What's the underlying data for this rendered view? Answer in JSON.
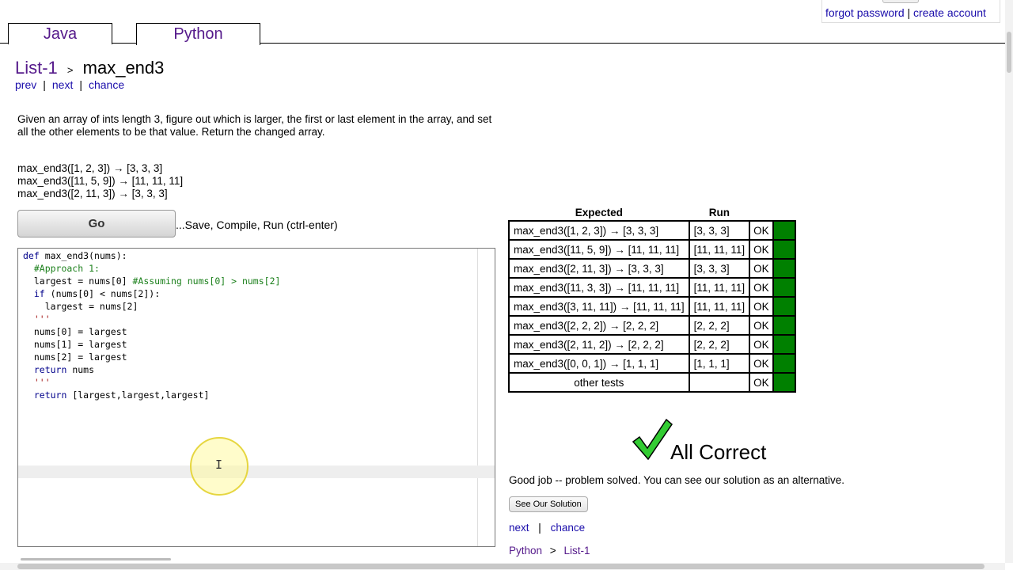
{
  "account": {
    "forgot": "forgot password",
    "sep": "|",
    "create": "create account"
  },
  "tabs": [
    {
      "label": "Java"
    },
    {
      "label": "Python"
    }
  ],
  "breadcrumb": {
    "section": "List-1",
    "sep": ">",
    "problem": "max_end3"
  },
  "nav": {
    "prev": "prev",
    "next": "next",
    "chance": "chance",
    "sep": "|"
  },
  "description": "Given an array of ints length 3, figure out which is larger, the first or last element in the array, and set all the other elements to be that value. Return the changed array.",
  "examples": [
    "max_end3([1, 2, 3]) → [3, 3, 3]",
    "max_end3([11, 5, 9]) → [11, 11, 11]",
    "max_end3([2, 11, 3]) → [3, 3, 3]"
  ],
  "go_button": "Go",
  "go_hint": "...Save, Compile, Run (ctrl-enter)",
  "code_lines": [
    "def max_end3(nums):",
    "",
    "  #Approach 1:",
    "",
    "  largest = nums[0] #Assuming nums[0] > nums[2]",
    "",
    "  if (nums[0] < nums[2]):",
    "    largest = nums[2]",
    "",
    "  '''",
    "  nums[0] = largest",
    "  nums[1] = largest",
    "  nums[2] = largest",
    "",
    "  return nums",
    "  '''",
    "",
    "  return [largest,largest,largest]"
  ],
  "results": {
    "headers": {
      "expected": "Expected",
      "run": "Run"
    },
    "rows": [
      {
        "expected": "max_end3([1, 2, 3]) → [3, 3, 3]",
        "run": "[3, 3, 3]",
        "status": "OK"
      },
      {
        "expected": "max_end3([11, 5, 9]) → [11, 11, 11]",
        "run": "[11, 11, 11]",
        "status": "OK"
      },
      {
        "expected": "max_end3([2, 11, 3]) → [3, 3, 3]",
        "run": "[3, 3, 3]",
        "status": "OK"
      },
      {
        "expected": "max_end3([11, 3, 3]) → [11, 11, 11]",
        "run": "[11, 11, 11]",
        "status": "OK"
      },
      {
        "expected": "max_end3([3, 11, 11]) → [11, 11, 11]",
        "run": "[11, 11, 11]",
        "status": "OK"
      },
      {
        "expected": "max_end3([2, 2, 2]) → [2, 2, 2]",
        "run": "[2, 2, 2]",
        "status": "OK"
      },
      {
        "expected": "max_end3([2, 11, 2]) → [2, 2, 2]",
        "run": "[2, 2, 2]",
        "status": "OK"
      },
      {
        "expected": "max_end3([0, 0, 1]) → [1, 1, 1]",
        "run": "[1, 1, 1]",
        "status": "OK"
      },
      {
        "expected": "other tests",
        "run": "",
        "status": "OK"
      }
    ],
    "pass_color": "#008000"
  },
  "all_correct": "All Correct",
  "good_job": "Good job -- problem solved. You can see our solution as an alternative.",
  "see_solution_button": "See Our Solution",
  "bottom_nav": {
    "next": "next",
    "sep": "|",
    "chance": "chance"
  },
  "bottom_crumb": {
    "lang": "Python",
    "sep": ">",
    "section": "List-1"
  },
  "colors": {
    "link_visited": "#551a8b",
    "link": "#1a0dab",
    "check": "#33cc33"
  }
}
